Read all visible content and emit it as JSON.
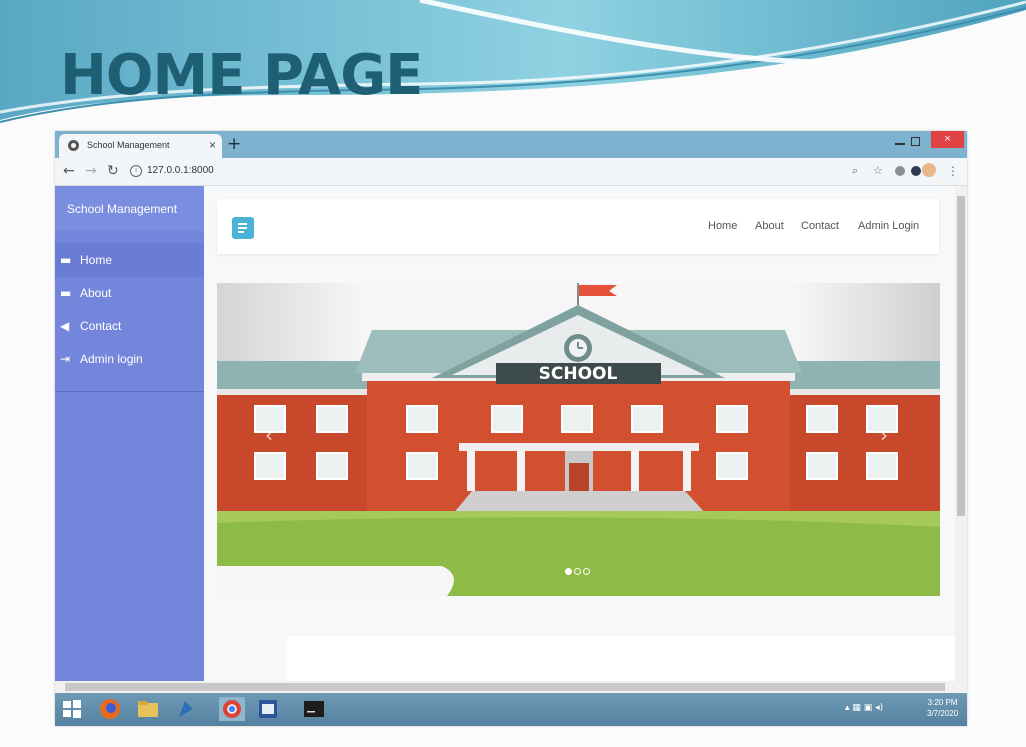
{
  "slide": {
    "title": "HOME PAGE"
  },
  "browser": {
    "tab_title": "School Management",
    "tab_close": "×",
    "new_tab": "+",
    "url": "127.0.0.1:8000"
  },
  "window_controls": {
    "close": "×"
  },
  "sidebar": {
    "brand": "School Management",
    "items": [
      {
        "label": "Home",
        "icon": "briefcase-icon",
        "active": true
      },
      {
        "label": "About",
        "icon": "briefcase-icon",
        "active": false
      },
      {
        "label": "Contact",
        "icon": "send-icon",
        "active": false
      },
      {
        "label": "Admin login",
        "icon": "login-icon",
        "active": false
      }
    ]
  },
  "navbar": {
    "links": [
      "Home",
      "About",
      "Contact",
      "Admin Login"
    ]
  },
  "carousel": {
    "sign_text": "SCHOOL",
    "slides": 3,
    "active_slide": 1
  },
  "taskbar": {
    "time": "3:20 PM",
    "date": "3/7/2020"
  },
  "colors": {
    "sidebar": "#7486db",
    "accent": "#4ab3d6",
    "title": "#1f5f73"
  }
}
